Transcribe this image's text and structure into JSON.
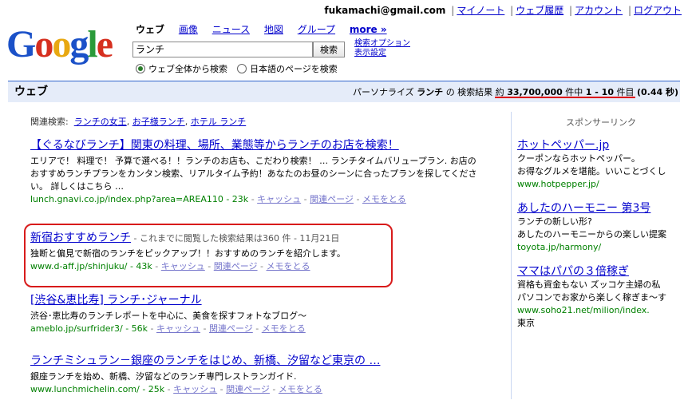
{
  "account": {
    "email": "fukamachi@gmail.com",
    "links": [
      "マイノート",
      "ウェブ履歴",
      "アカウント",
      "ログアウト"
    ]
  },
  "logo": {
    "text": "Google"
  },
  "tabs": {
    "web": "ウェブ",
    "images": "画像",
    "news": "ニュース",
    "maps": "地図",
    "groups": "グループ",
    "more": "more »"
  },
  "search": {
    "value": "ランチ",
    "button": "検索",
    "advanced": "検索オプション",
    "preferences": "表示設定",
    "radio_all": "ウェブ全体から検索",
    "radio_ja": "日本語のページを検索"
  },
  "bar": {
    "title": "ウェブ",
    "prefix": "パーソナライズ",
    "query": "ランチ",
    "mid": "の 検索結果 約",
    "count": "33,700,000",
    "unit1": "件中",
    "range": "1 - 10",
    "unit2": "件目",
    "time": "(0.44 秒)"
  },
  "related": {
    "label": "関連検索:",
    "items": [
      "ランチの女王",
      "お子様ランチ",
      "ホテル ランチ"
    ]
  },
  "results": [
    {
      "title": "【ぐるなびランチ】関東の料理、場所、業態等からランチのお店を検索！",
      "title_extra": "",
      "snippet": "エリアで！ 料理で！ 予算で選べる！！ランチのお店も、こだわり検索！ … ランチタイムバリュープラン. お店のおすすめランチプランをカンタン検索、リアルタイム予約！あなたのお昼のシーンに合ったプランを探してください。 詳しくはこちら …",
      "url": "lunch.gnavi.co.jp/index.php?area=AREA110 - 23k",
      "cache": "キャッシュ",
      "similar": "関連ページ",
      "note": "メモをとる"
    },
    {
      "title": "新宿おすすめランチ",
      "title_extra": "- これまでに閲覧した検索結果は360 件 - 11月21日",
      "snippet": "独断と偏見で新宿のランチをピックアップ！！おすすめのランチを紹介します。",
      "url": "www.d-aff.jp/shinjuku/ - 43k",
      "cache": "キャッシュ",
      "similar": "関連ページ",
      "note": "メモをとる"
    },
    {
      "title": "[渋谷&恵比寿] ランチ･ジャーナル",
      "title_extra": "",
      "snippet": "渋谷･恵比寿のランチレポートを中心に、美食を探すフォトなブログ～",
      "url": "ameblo.jp/surfrider3/ - 56k",
      "cache": "キャッシュ",
      "similar": "関連ページ",
      "note": "メモをとる"
    },
    {
      "title": "ランチミシュラン－銀座のランチをはじめ、新橋、汐留など東京の …",
      "title_extra": "",
      "snippet": "銀座ランチを始め、新橋、汐留などのランチ専門レストランガイド.",
      "url": "www.lunchmichelin.com/ - 25k",
      "cache": "キャッシュ",
      "similar": "関連ページ",
      "note": "メモをとる"
    }
  ],
  "sponsored": {
    "header": "スポンサーリンク",
    "ads": [
      {
        "title": "ホットペッパー.jp",
        "line1": "クーポンならホットペッパー。",
        "line2": "お得なグルメを堪能。いいことづくし",
        "url": "www.hotpepper.jp/",
        "extra": ""
      },
      {
        "title": "あしたのハーモニー 第3号",
        "line1": "ランチの新しい形?",
        "line2": "あしたのハーモニーからの楽しい提案",
        "url": "toyota.jp/harmony/",
        "extra": ""
      },
      {
        "title": "ママはパパの３倍稼ぎ",
        "line1": "資格も資金もない ズッコケ主婦の私",
        "line2": "パソコンでお家から楽しく稼ぎま～す",
        "url": "www.soho21.net/milion/index.",
        "extra": "東京"
      }
    ]
  },
  "colors": {
    "link": "#0000cc",
    "url": "#008000",
    "bar_bg": "#e5ecf9",
    "highlight": "#d81b1b"
  }
}
